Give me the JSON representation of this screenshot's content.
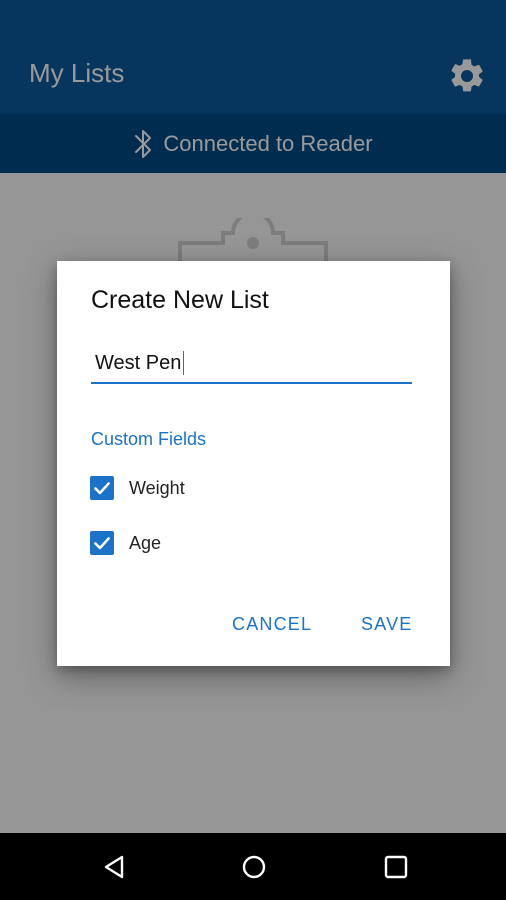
{
  "app_bar": {
    "title": "My Lists",
    "settings_icon": "gear-icon",
    "background_color": "#0a5a9c"
  },
  "connection_status": {
    "icon": "bluetooth-icon",
    "text": "Connected to Reader",
    "background_color": "#004a86"
  },
  "dialog": {
    "title": "Create New List",
    "name_field": {
      "value": "West Pen",
      "placeholder": ""
    },
    "custom_fields_label": "Custom Fields",
    "custom_fields": [
      {
        "label": "Weight",
        "checked": true
      },
      {
        "label": "Age",
        "checked": true
      }
    ],
    "buttons": {
      "cancel_label": "CANCEL",
      "save_label": "SAVE"
    },
    "accent_color": "#1a73c9"
  },
  "nav_bar": {
    "back_icon": "back-triangle-icon",
    "home_icon": "home-circle-icon",
    "recents_icon": "recents-square-icon"
  }
}
